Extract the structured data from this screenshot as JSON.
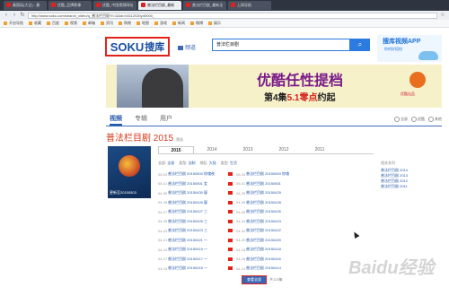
{
  "browser": {
    "tabs": [
      "秦国局(大全) - 最",
      "优酷_品牌影像",
      "优酷_中国视频网站",
      "普法栏目剧_最新",
      "普法栏目剧_最新全",
      "上网导航"
    ],
    "active_tab": 3,
    "url": "http://www.soku.com/search_video/q_普法栏目剧?f=1&kb=04112020y40000_",
    "bookmarks": [
      "开启导航",
      "收藏",
      "百度",
      "视频",
      "邮箱",
      "资讯",
      "购物",
      "地图",
      "游戏",
      "新闻",
      "微博",
      "娱乐"
    ]
  },
  "header": {
    "logo_text": "SOKU",
    "logo_cn": "搜库",
    "channel": "频道",
    "search_value": "普法栏目剧",
    "search_icon": "search-icon",
    "app_title": "搜库视频APP",
    "app_sub": "你的好搭档"
  },
  "banner": {
    "headline": "优酷任性提档",
    "subline_a": "第4集",
    "subline_b": "5.1零点",
    "subline_c": "约起",
    "brand": "优酷出品"
  },
  "tabs": {
    "items": [
      "视频",
      "专辑",
      "用户"
    ],
    "sort": [
      "全部",
      "优酷",
      "其他"
    ]
  },
  "series": {
    "title": "普法栏目剧 2015",
    "subtitle": "筛选",
    "years": [
      "2015",
      "2014",
      "2013",
      "2012",
      "2011"
    ],
    "poster_caption": "更新至20150503",
    "info": [
      "全部",
      "法制",
      "大陆",
      "生活"
    ]
  },
  "episodes": [
    [
      "05-03",
      "普法栏目剧 20150503 惊魂夜",
      "05-03",
      "普法栏目剧 20150503 惊魂"
    ],
    [
      "05-01",
      "普法栏目剧 20150501 女",
      "05-01",
      "普法栏目剧 20150501"
    ],
    [
      "04-30",
      "普法栏目剧 20150430 疑",
      "04-29",
      "普法栏目剧 20150429"
    ],
    [
      "04-28",
      "普法栏目剧 20150428 疑",
      "04-28",
      "普法栏目剧 20150428"
    ],
    [
      "04-27",
      "普法栏目剧 20150427 三",
      "04-26",
      "普法栏目剧 20150426"
    ],
    [
      "04-25",
      "普法栏目剧 20150425 三",
      "04-24",
      "普法栏目剧 20150424"
    ],
    [
      "04-23",
      "普法栏目剧 20150423 三",
      "04-22",
      "普法栏目剧 20150422"
    ],
    [
      "04-21",
      "普法栏目剧 20150421 一",
      "04-20",
      "普法栏目剧 20150420"
    ],
    [
      "04-19",
      "普法栏目剧 20150419 一",
      "04-18",
      "普法栏目剧 20150418"
    ],
    [
      "04-17",
      "普法栏目剧 20150417 一",
      "04-16",
      "普法栏目剧 20150416"
    ],
    [
      "04-15",
      "普法栏目剧 20150415 一",
      "04-14",
      "普法栏目剧 20150414"
    ]
  ],
  "more_button": "查看全部",
  "more_count": "共120集",
  "related": {
    "title": "相关系列",
    "items": [
      "普法栏目剧 2014",
      "普法栏目剧 2013",
      "普法栏目剧 2012",
      "普法栏目剧 2011"
    ]
  },
  "watermark": "Baidu经验"
}
